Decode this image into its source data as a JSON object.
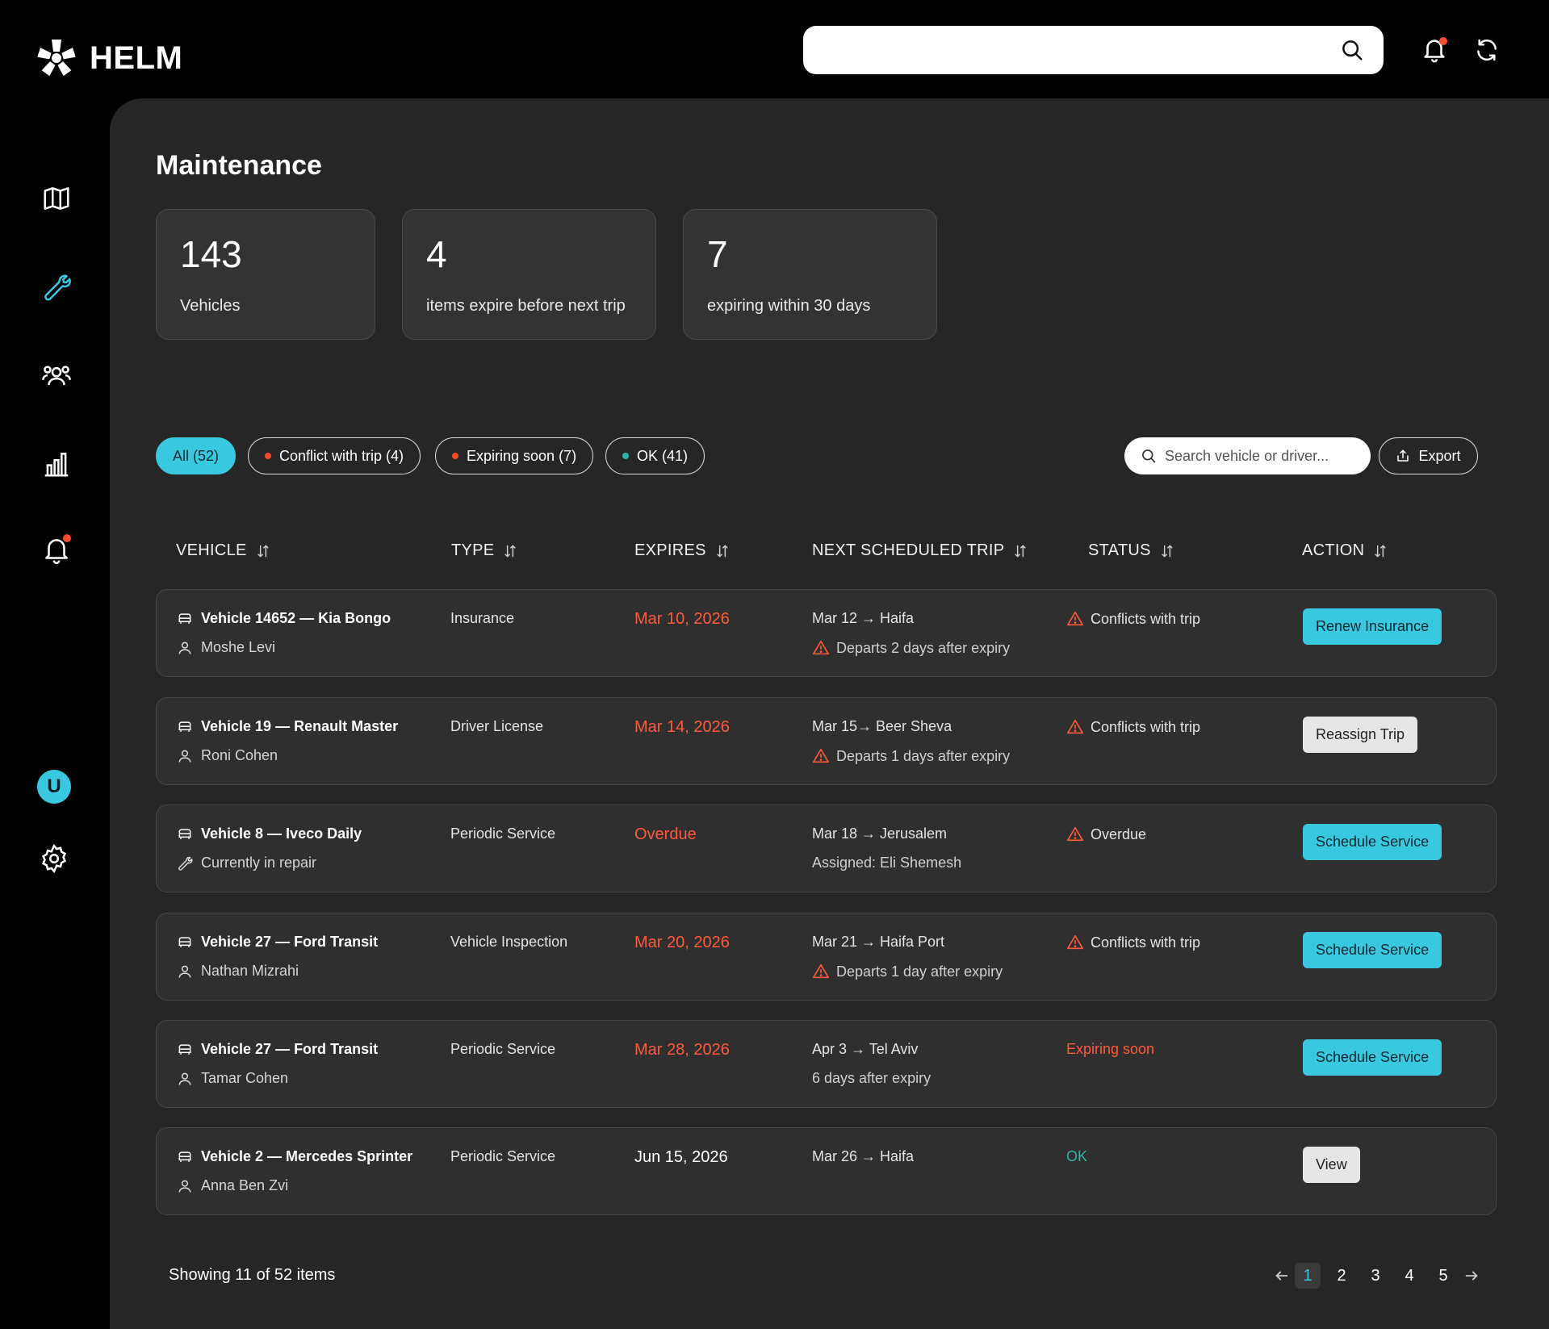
{
  "app": {
    "name": "HELM"
  },
  "page": {
    "title": "Maintenance"
  },
  "stats": [
    {
      "value": "143",
      "label": "Vehicles"
    },
    {
      "value": "4",
      "label": "items expire before next trip"
    },
    {
      "value": "7",
      "label": "expiring within 30 days"
    }
  ],
  "filters": [
    {
      "label": "All (52)",
      "active": true
    },
    {
      "label": "Conflict with trip (4)",
      "dot_color": "#ff4a2b"
    },
    {
      "label": "Expiring soon (7)",
      "dot_color": "#ff4a2b"
    },
    {
      "label": "OK (41)",
      "dot_color": "#2eb5a8"
    }
  ],
  "search": {
    "placeholder": "Search vehicle or driver..."
  },
  "export_label": "Export",
  "columns": [
    "VEHICLE",
    "TYPE",
    "EXPIRES",
    "NEXT SCHEDULED TRIP",
    "STATUS",
    "ACTION"
  ],
  "rows": [
    {
      "vehicle": "Vehicle 14652 — Kia Bongo",
      "sub": "Moshe Levi",
      "sub_icon": "user-icon",
      "type": "Insurance",
      "expires": "Mar 10, 2026",
      "trip": "Mar 12 → Haifa",
      "trip_sub": "Departs 2 days after expiry",
      "trip_warn": true,
      "status": "Conflicts with trip",
      "status_kind": "warn",
      "action": "Renew Insurance",
      "action_style": "cyan"
    },
    {
      "vehicle": "Vehicle 19 — Renault Master",
      "sub": "Roni Cohen",
      "sub_icon": "user-icon",
      "type": "Driver License",
      "expires": "Mar 14, 2026",
      "trip": "Mar 15→ Beer Sheva",
      "trip_sub": "Departs 1 days after expiry",
      "trip_warn": true,
      "status": "Conflicts with trip",
      "status_kind": "warn",
      "action": "Reassign Trip",
      "action_style": "gray"
    },
    {
      "vehicle": "Vehicle 8 — Iveco Daily",
      "sub": "Currently in repair",
      "sub_icon": "wrench-icon",
      "type": "Periodic Service",
      "expires": "Overdue",
      "trip": "Mar 18 → Jerusalem",
      "trip_sub": "Assigned: Eli Shemesh",
      "trip_warn": false,
      "status": "Overdue",
      "status_kind": "warn",
      "action": "Schedule Service",
      "action_style": "cyan"
    },
    {
      "vehicle": "Vehicle 27 — Ford Transit",
      "sub": "Nathan Mizrahi",
      "sub_icon": "user-icon",
      "type": "Vehicle Inspection",
      "expires": "Mar 20, 2026",
      "trip": "Mar 21 → Haifa Port",
      "trip_sub": "Departs 1 day after expiry",
      "trip_warn": true,
      "status": "Conflicts with trip",
      "status_kind": "warn",
      "action": "Schedule Service",
      "action_style": "cyan"
    },
    {
      "vehicle": "Vehicle 27 — Ford Transit",
      "sub": "Tamar Cohen",
      "sub_icon": "user-icon",
      "type": "Periodic Service",
      "expires": "Mar 28, 2026",
      "trip": "Apr 3 → Tel Aviv",
      "trip_sub": "6 days after expiry",
      "trip_warn": false,
      "status": "Expiring soon",
      "status_kind": "orange",
      "action": "Schedule Service",
      "action_style": "cyan"
    },
    {
      "vehicle": "Vehicle 2 — Mercedes Sprinter",
      "sub": "Anna Ben Zvi",
      "sub_icon": "user-icon",
      "type": "Periodic Service",
      "expires": "Jun 15, 2026",
      "trip": "Mar 26 → Haifa",
      "trip_sub": "",
      "trip_warn": false,
      "status": "OK",
      "status_kind": "ok",
      "action": "View",
      "action_style": "gray"
    }
  ],
  "footer": {
    "showing": "Showing 11 of 52 items"
  },
  "pagination": {
    "pages": [
      "1",
      "2",
      "3",
      "4",
      "5"
    ],
    "current": "1"
  },
  "user": {
    "initial": "U"
  },
  "colors": {
    "accent": "#38c8e0",
    "danger": "#ff5a3a",
    "ok": "#2eb5a8"
  }
}
